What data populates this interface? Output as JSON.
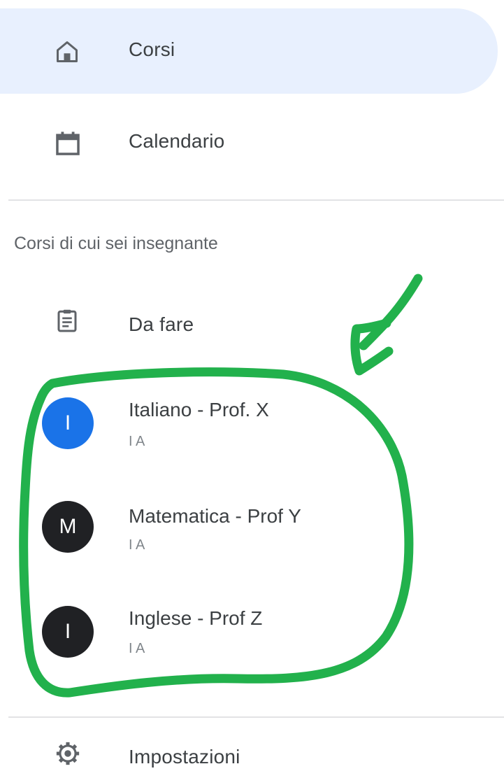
{
  "nav": {
    "courses_label": "Corsi",
    "calendar_label": "Calendario"
  },
  "section": {
    "heading": "Corsi di cui sei insegnante"
  },
  "todo": {
    "label": "Da fare"
  },
  "courses": [
    {
      "initial": "I",
      "name": "Italiano - Prof. X",
      "section": "I A",
      "color": "#1a73e8"
    },
    {
      "initial": "M",
      "name": "Matematica - Prof Y",
      "section": "I A",
      "color": "#202124"
    },
    {
      "initial": "I",
      "name": "Inglese - Prof Z",
      "section": "I A",
      "color": "#202124"
    }
  ],
  "settings": {
    "label": "Impostazioni"
  },
  "icons": {
    "home": "home-icon",
    "calendar": "calendar-icon",
    "todo": "clipboard-icon",
    "settings": "gear-icon"
  },
  "annotation": {
    "color": "#22b14c",
    "shapes": [
      "arrow",
      "circle"
    ]
  },
  "colors": {
    "selected_background": "#e8f0fe",
    "text": "#3c4043",
    "section_heading": "#5f6368",
    "divider": "#e2e3e5"
  }
}
